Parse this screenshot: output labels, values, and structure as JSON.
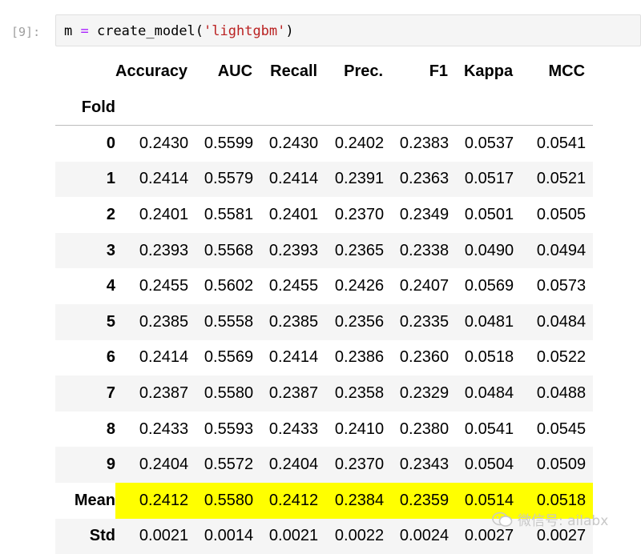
{
  "prompt": "[9]:",
  "code": {
    "var": "m ",
    "op": "=",
    "func": " create_model(",
    "arg": "'lightgbm'",
    "close": ")"
  },
  "table": {
    "columns": [
      "Accuracy",
      "AUC",
      "Recall",
      "Prec.",
      "F1",
      "Kappa",
      "MCC"
    ],
    "index_name": "Fold",
    "rows": [
      {
        "label": "0",
        "values": [
          "0.2430",
          "0.5599",
          "0.2430",
          "0.2402",
          "0.2383",
          "0.0537",
          "0.0541"
        ]
      },
      {
        "label": "1",
        "values": [
          "0.2414",
          "0.5579",
          "0.2414",
          "0.2391",
          "0.2363",
          "0.0517",
          "0.0521"
        ]
      },
      {
        "label": "2",
        "values": [
          "0.2401",
          "0.5581",
          "0.2401",
          "0.2370",
          "0.2349",
          "0.0501",
          "0.0505"
        ]
      },
      {
        "label": "3",
        "values": [
          "0.2393",
          "0.5568",
          "0.2393",
          "0.2365",
          "0.2338",
          "0.0490",
          "0.0494"
        ]
      },
      {
        "label": "4",
        "values": [
          "0.2455",
          "0.5602",
          "0.2455",
          "0.2426",
          "0.2407",
          "0.0569",
          "0.0573"
        ]
      },
      {
        "label": "5",
        "values": [
          "0.2385",
          "0.5558",
          "0.2385",
          "0.2356",
          "0.2335",
          "0.0481",
          "0.0484"
        ]
      },
      {
        "label": "6",
        "values": [
          "0.2414",
          "0.5569",
          "0.2414",
          "0.2386",
          "0.2360",
          "0.0518",
          "0.0522"
        ]
      },
      {
        "label": "7",
        "values": [
          "0.2387",
          "0.5580",
          "0.2387",
          "0.2358",
          "0.2329",
          "0.0484",
          "0.0488"
        ]
      },
      {
        "label": "8",
        "values": [
          "0.2433",
          "0.5593",
          "0.2433",
          "0.2410",
          "0.2380",
          "0.0541",
          "0.0545"
        ]
      },
      {
        "label": "9",
        "values": [
          "0.2404",
          "0.5572",
          "0.2404",
          "0.2370",
          "0.2343",
          "0.0504",
          "0.0509"
        ]
      },
      {
        "label": "Mean",
        "values": [
          "0.2412",
          "0.5580",
          "0.2412",
          "0.2384",
          "0.2359",
          "0.0514",
          "0.0518"
        ],
        "highlight": true
      },
      {
        "label": "Std",
        "values": [
          "0.0021",
          "0.0014",
          "0.0021",
          "0.0022",
          "0.0024",
          "0.0027",
          "0.0027"
        ]
      }
    ],
    "highlight_color": "#ffff00"
  },
  "watermark": {
    "icon": "wechat-icon",
    "text": "微信号: ailabx"
  }
}
